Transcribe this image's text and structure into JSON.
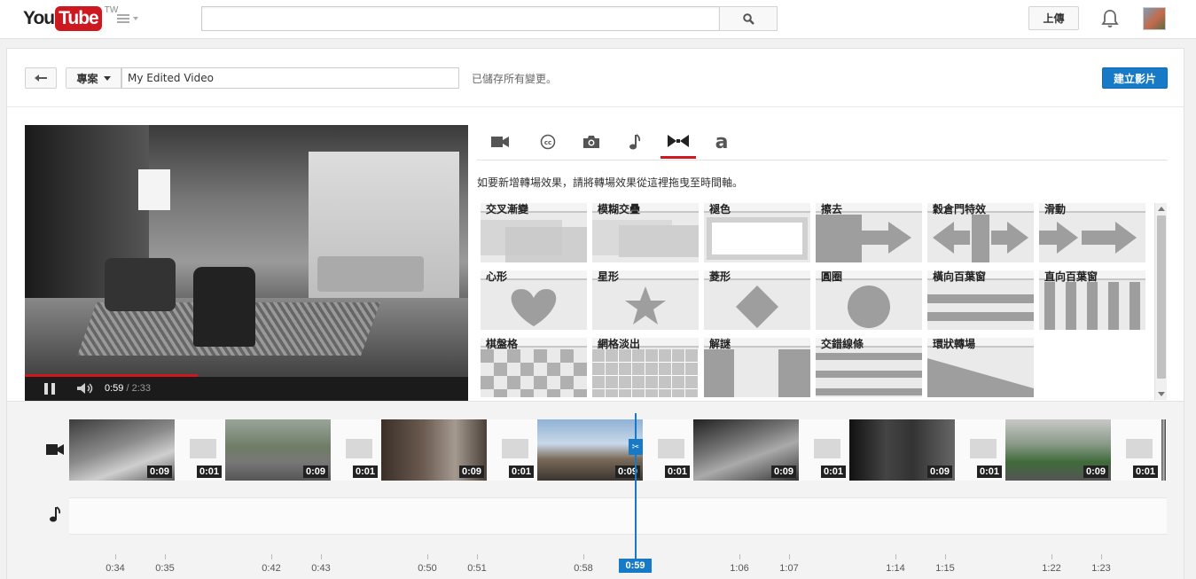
{
  "masthead": {
    "logo_you": "You",
    "logo_tube": "Tube",
    "logo_region": "TW",
    "search_placeholder": "",
    "upload_label": "上傳"
  },
  "editor": {
    "project_label": "專案",
    "title_value": "My Edited Video",
    "saved_status": "已儲存所有變更。",
    "create_label": "建立影片"
  },
  "player": {
    "current_time": "0:59",
    "duration": "/ 2:33",
    "progress": 0.39
  },
  "tools": {
    "tabs": [
      {
        "name": "video-camera-icon",
        "label": "video"
      },
      {
        "name": "cc-icon",
        "label": "cc"
      },
      {
        "name": "photo-camera-icon",
        "label": "photo"
      },
      {
        "name": "music-note-icon",
        "label": "music"
      },
      {
        "name": "transitions-icon",
        "label": "transitions"
      },
      {
        "name": "text-icon",
        "label": "a"
      }
    ],
    "active_tab": 4,
    "hint": "如要新增轉場效果，請將轉場效果從這裡拖曳至時間軸。",
    "transitions": [
      [
        "交叉漸變",
        "模糊交疊",
        "褪色",
        "擦去",
        "穀倉門特效",
        "滑動"
      ],
      [
        "心形",
        "星形",
        "菱形",
        "圓圈",
        "橫向百葉窗",
        "直向百葉窗"
      ],
      [
        "棋盤格",
        "網格淡出",
        "解謎",
        "交錯線條",
        "環狀轉場"
      ]
    ]
  },
  "timeline": {
    "clips": [
      {
        "duration": "0:09",
        "kind": "video"
      },
      {
        "duration": "0:01",
        "kind": "transition"
      },
      {
        "duration": "0:09",
        "kind": "video"
      },
      {
        "duration": "0:01",
        "kind": "transition"
      },
      {
        "duration": "0:09",
        "kind": "video"
      },
      {
        "duration": "0:01",
        "kind": "transition"
      },
      {
        "duration": "0:09",
        "kind": "video"
      },
      {
        "duration": "0:01",
        "kind": "transition"
      },
      {
        "duration": "0:09",
        "kind": "video"
      },
      {
        "duration": "0:01",
        "kind": "transition"
      },
      {
        "duration": "0:09",
        "kind": "video"
      },
      {
        "duration": "0:01",
        "kind": "transition"
      },
      {
        "duration": "0:09",
        "kind": "video"
      },
      {
        "duration": "0:01",
        "kind": "transition"
      },
      {
        "duration": "",
        "kind": "video"
      }
    ],
    "ruler_labels": [
      "0:34",
      "0:35",
      "0:42",
      "0:43",
      "0:50",
      "0:51",
      "0:58",
      "1:06",
      "1:07",
      "1:14",
      "1:15",
      "1:22",
      "1:23"
    ],
    "playhead_time": "0:59",
    "playhead_marker": "✂"
  },
  "colors": {
    "brand_red": "#cc181e",
    "accent_blue": "#167ac6"
  }
}
